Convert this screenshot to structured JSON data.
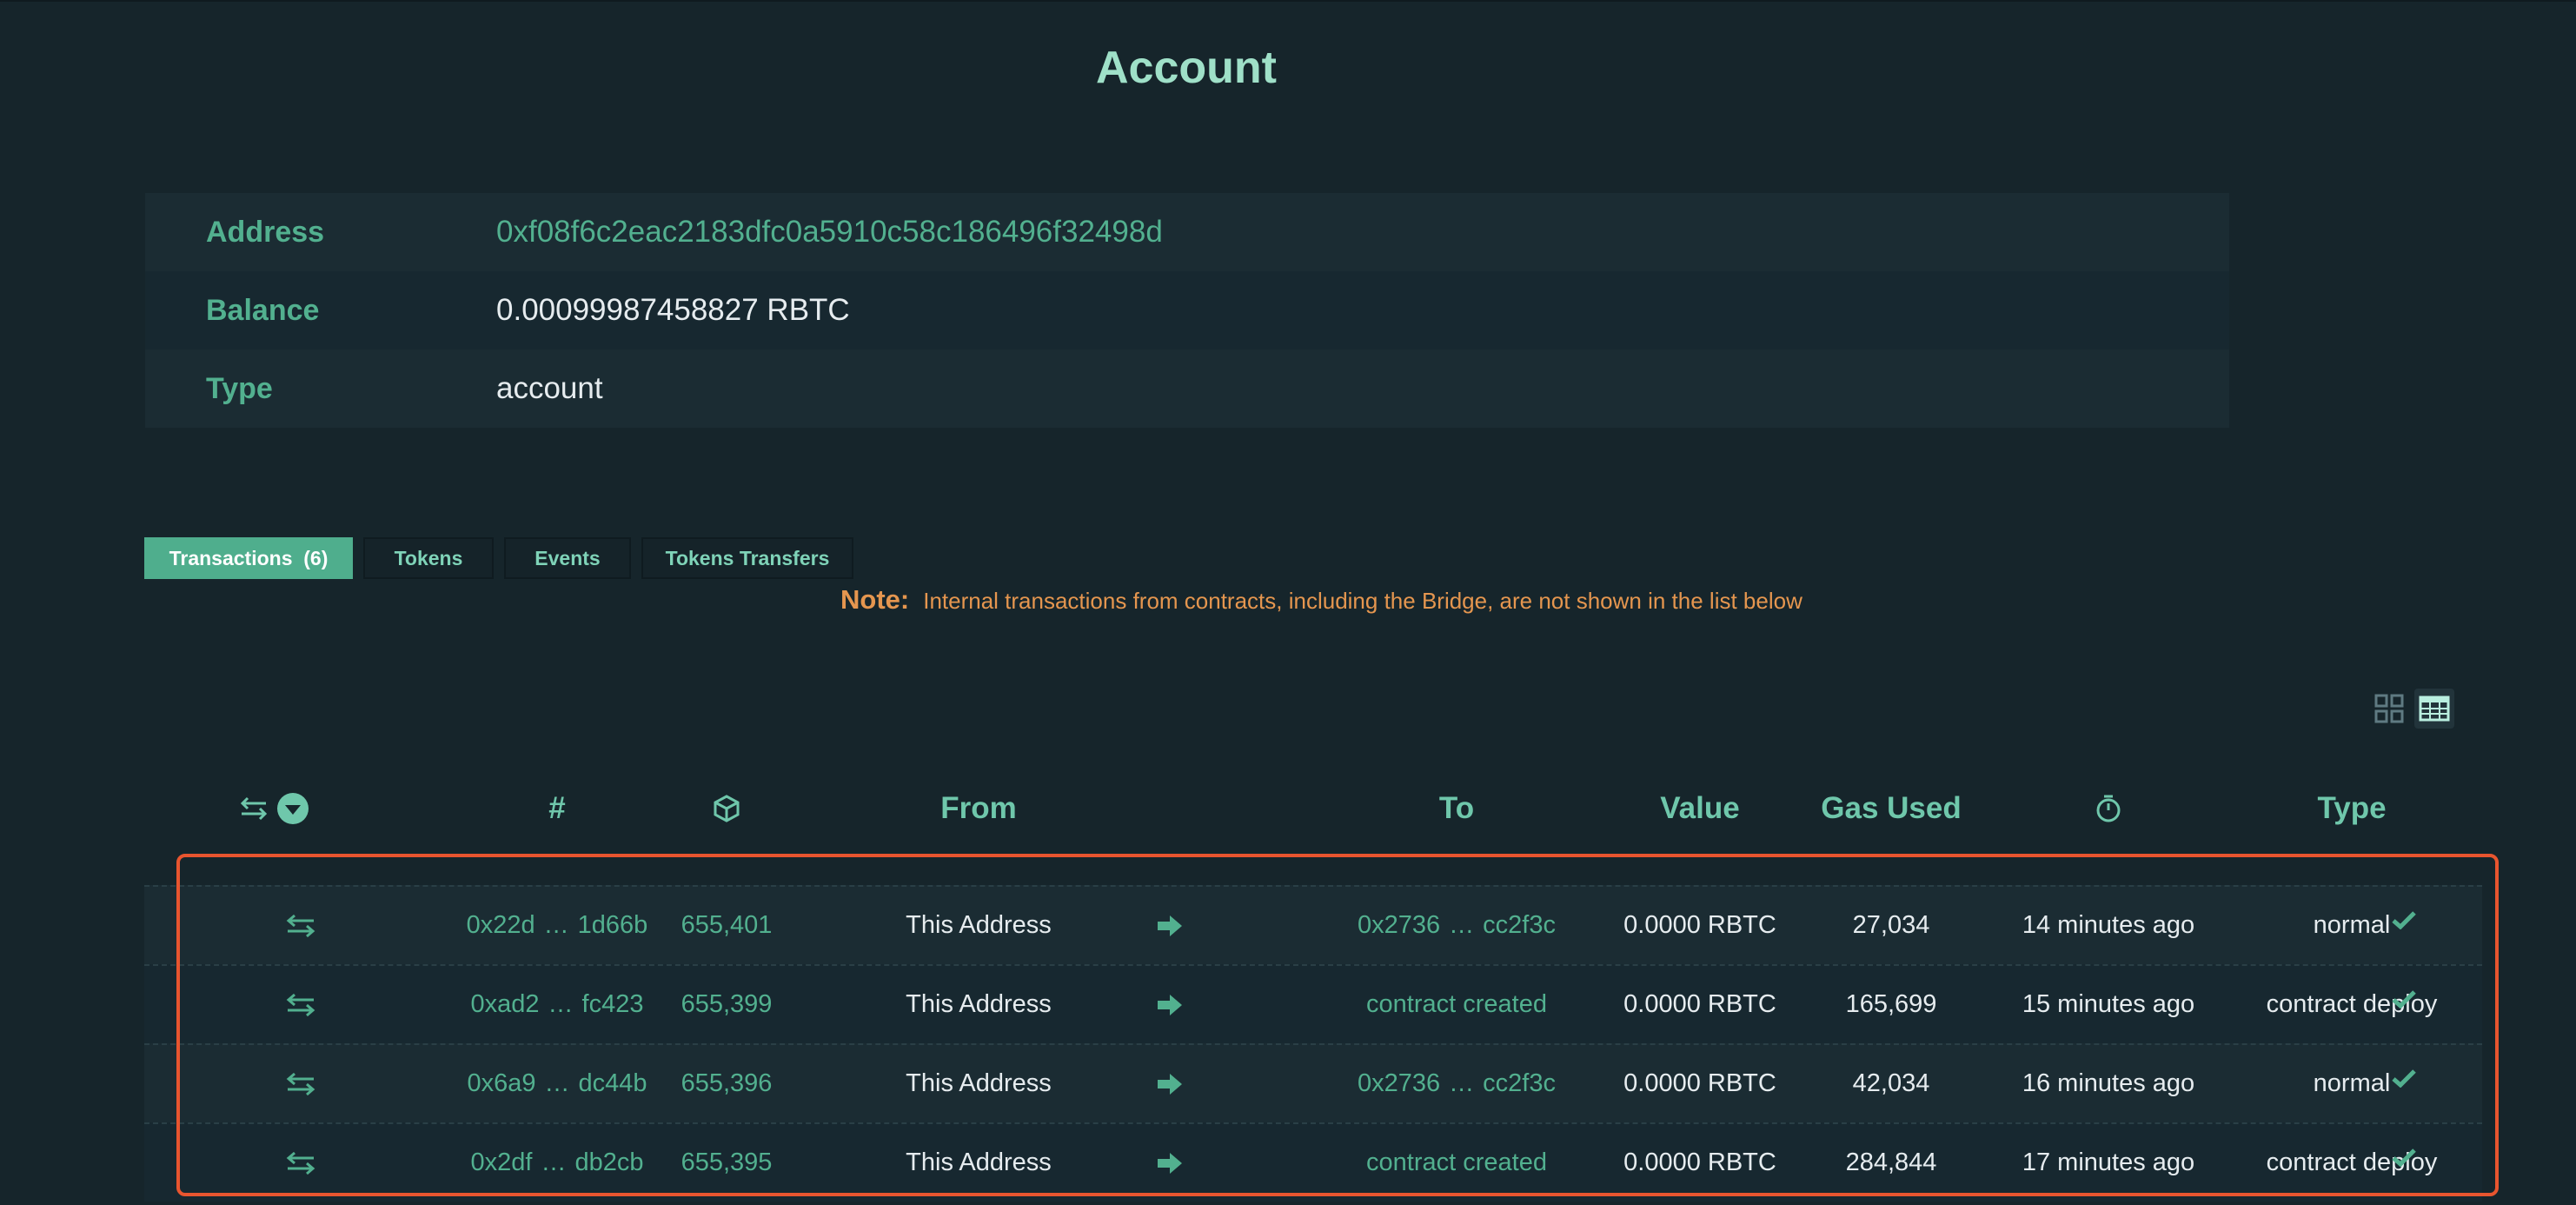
{
  "page": {
    "title": "Account"
  },
  "account": {
    "address_label": "Address",
    "address_value": "0xf08f6c2eac2183dfc0a5910c58c186496f32498d",
    "balance_label": "Balance",
    "balance_value": "0.00099987458827 RBTC",
    "type_label": "Type",
    "type_value": "account"
  },
  "tabs": [
    {
      "label": "Transactions",
      "count": "(6)",
      "active": true
    },
    {
      "label": "Tokens"
    },
    {
      "label": "Events"
    },
    {
      "label": "Tokens Transfers"
    }
  ],
  "note": {
    "label": "Note:",
    "text": "Internal transactions from contracts, including the Bridge, are not shown in the list below"
  },
  "view_toggle": {
    "grid_icon": "grid-view-icon",
    "table_icon": "table-view-icon",
    "active": "table"
  },
  "table": {
    "headers": {
      "direction_icon": "transfer-arrows-icon",
      "sort_icon": "sort-down-circle-icon",
      "hash": "#",
      "block_icon": "cube-icon",
      "from": "From",
      "to": "To",
      "value": "Value",
      "gas_used": "Gas Used",
      "time_icon": "stopwatch-icon",
      "type": "Type"
    },
    "rows": [
      {
        "hash_start": "0x22d",
        "hash_end": "1d66b",
        "block": "655,401",
        "from": "This Address",
        "to_start": "0x2736",
        "to_end": "cc2f3c",
        "to_text": "",
        "value": "0.0000 RBTC",
        "gas": "27,034",
        "time": "14 minutes ago",
        "type": "normal"
      },
      {
        "hash_start": "0xad2",
        "hash_end": "fc423",
        "block": "655,399",
        "from": "This Address",
        "to_start": "",
        "to_end": "",
        "to_text": "contract created",
        "value": "0.0000 RBTC",
        "gas": "165,699",
        "time": "15 minutes ago",
        "type": "contract deploy"
      },
      {
        "hash_start": "0x6a9",
        "hash_end": "dc44b",
        "block": "655,396",
        "from": "This Address",
        "to_start": "0x2736",
        "to_end": "cc2f3c",
        "to_text": "",
        "value": "0.0000 RBTC",
        "gas": "42,034",
        "time": "16 minutes ago",
        "type": "normal"
      },
      {
        "hash_start": "0x2df",
        "hash_end": "db2cb",
        "block": "655,395",
        "from": "This Address",
        "to_start": "",
        "to_end": "",
        "to_text": "contract created",
        "value": "0.0000 RBTC",
        "gas": "284,844",
        "time": "17 minutes ago",
        "type": "contract deploy"
      }
    ],
    "ellipsis": "…"
  },
  "colors": {
    "background": "#16252b",
    "accent": "#52b08f",
    "note": "#e5964f",
    "highlight": "#e8552f"
  }
}
